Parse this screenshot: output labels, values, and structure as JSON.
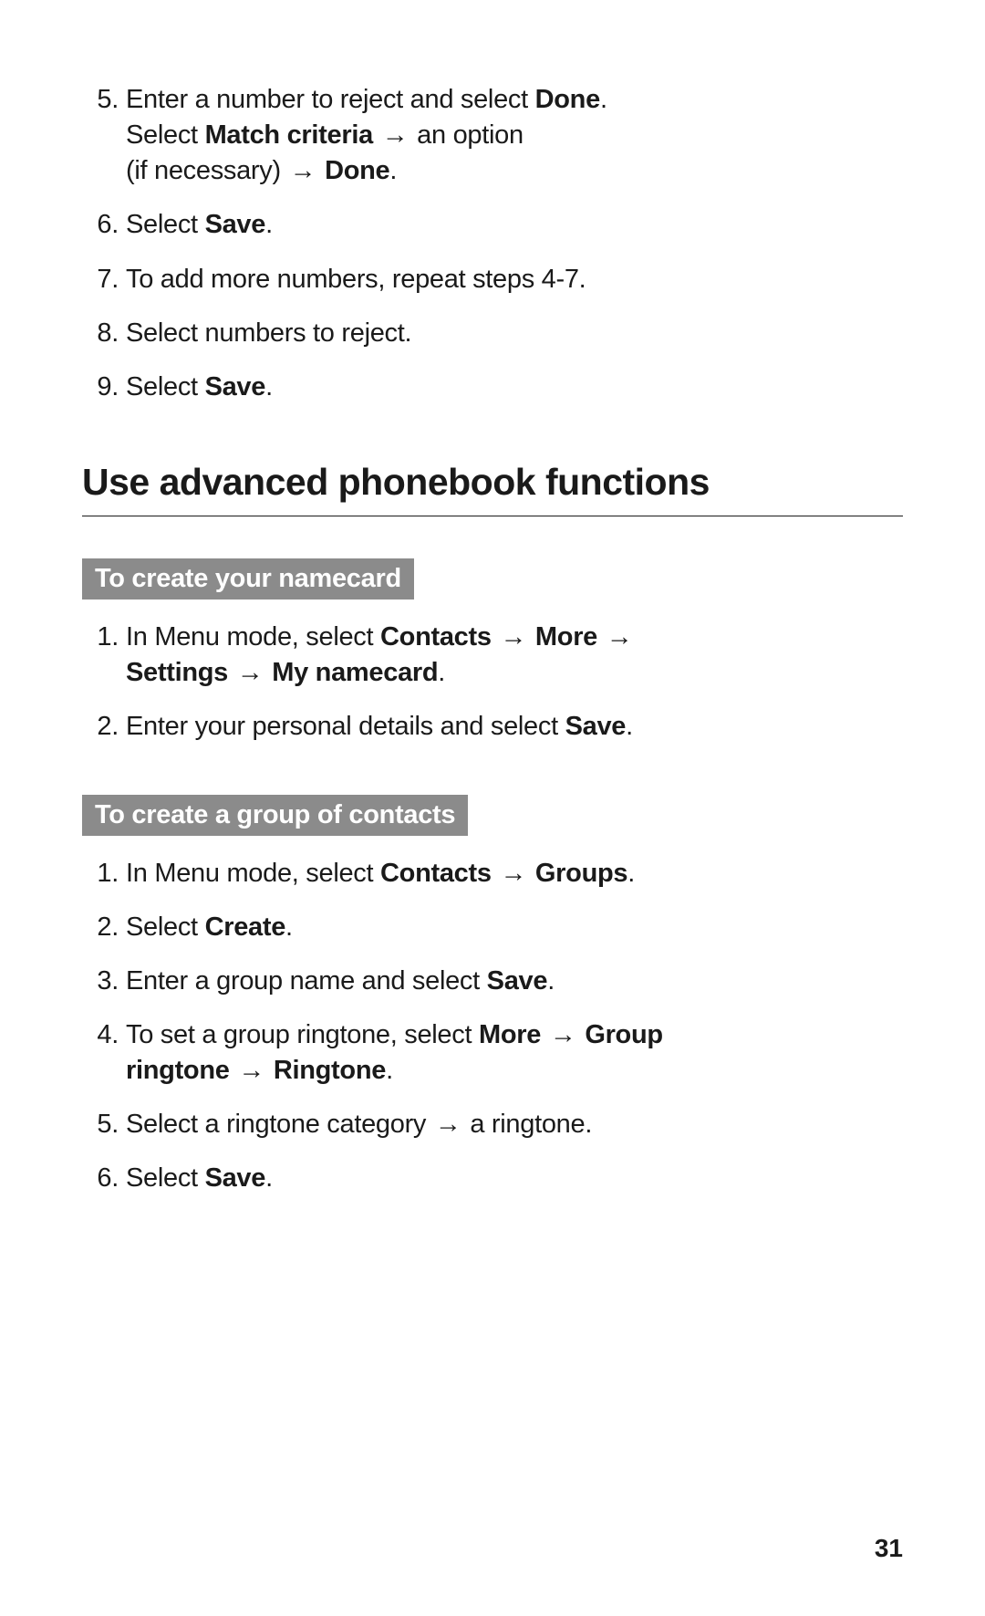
{
  "arrow": "→",
  "topList": [
    {
      "num": "5.",
      "segments": [
        {
          "t": "Enter a number to reject and select "
        },
        {
          "t": "Done",
          "b": true
        },
        {
          "t": "."
        },
        {
          "br": true
        },
        {
          "t": "Select "
        },
        {
          "t": "Match criteria",
          "b": true
        },
        {
          "t": " "
        },
        {
          "arrow": true
        },
        {
          "t": " an option"
        },
        {
          "br": true
        },
        {
          "t": "(if necessary) "
        },
        {
          "arrow": true
        },
        {
          "t": " "
        },
        {
          "t": "Done",
          "b": true
        },
        {
          "t": "."
        }
      ]
    },
    {
      "num": "6.",
      "segments": [
        {
          "t": "Select "
        },
        {
          "t": "Save",
          "b": true
        },
        {
          "t": "."
        }
      ]
    },
    {
      "num": "7.",
      "segments": [
        {
          "t": "To add more numbers, repeat steps 4-7."
        }
      ]
    },
    {
      "num": "8.",
      "segments": [
        {
          "t": "Select numbers to reject."
        }
      ]
    },
    {
      "num": "9.",
      "segments": [
        {
          "t": "Select "
        },
        {
          "t": "Save",
          "b": true
        },
        {
          "t": "."
        }
      ]
    }
  ],
  "sectionTitle": "Use advanced phonebook functions",
  "sub1": {
    "header": "To create your namecard",
    "items": [
      {
        "num": "1.",
        "segments": [
          {
            "t": "In Menu mode, select "
          },
          {
            "t": "Contacts",
            "b": true
          },
          {
            "t": " "
          },
          {
            "arrow": true
          },
          {
            "t": " "
          },
          {
            "t": "More",
            "b": true
          },
          {
            "t": " "
          },
          {
            "arrow": true
          },
          {
            "br": true
          },
          {
            "t": "Settings",
            "b": true
          },
          {
            "t": " "
          },
          {
            "arrow": true
          },
          {
            "t": " "
          },
          {
            "t": "My namecard",
            "b": true
          },
          {
            "t": "."
          }
        ]
      },
      {
        "num": "2.",
        "segments": [
          {
            "t": "Enter your personal details and select "
          },
          {
            "t": "Save",
            "b": true
          },
          {
            "t": "."
          }
        ]
      }
    ]
  },
  "sub2": {
    "header": "To create a group of contacts",
    "items": [
      {
        "num": "1.",
        "segments": [
          {
            "t": "In Menu mode, select "
          },
          {
            "t": "Contacts",
            "b": true
          },
          {
            "t": " "
          },
          {
            "arrow": true
          },
          {
            "t": " "
          },
          {
            "t": "Groups",
            "b": true
          },
          {
            "t": "."
          }
        ]
      },
      {
        "num": "2.",
        "segments": [
          {
            "t": "Select "
          },
          {
            "t": "Create",
            "b": true
          },
          {
            "t": "."
          }
        ]
      },
      {
        "num": "3.",
        "segments": [
          {
            "t": "Enter a group name and select "
          },
          {
            "t": "Save",
            "b": true
          },
          {
            "t": "."
          }
        ]
      },
      {
        "num": "4.",
        "segments": [
          {
            "t": "To set a group ringtone, select "
          },
          {
            "t": "More",
            "b": true
          },
          {
            "t": " "
          },
          {
            "arrow": true
          },
          {
            "t": " "
          },
          {
            "t": "Group",
            "b": true
          },
          {
            "br": true
          },
          {
            "t": "ringtone",
            "b": true
          },
          {
            "t": " "
          },
          {
            "arrow": true
          },
          {
            "t": " "
          },
          {
            "t": "Ringtone",
            "b": true
          },
          {
            "t": "."
          }
        ]
      },
      {
        "num": "5.",
        "segments": [
          {
            "t": "Select a ringtone category "
          },
          {
            "arrow": true
          },
          {
            "t": " a ringtone."
          }
        ]
      },
      {
        "num": "6.",
        "segments": [
          {
            "t": "Select "
          },
          {
            "t": "Save",
            "b": true
          },
          {
            "t": "."
          }
        ]
      }
    ]
  },
  "pageNumber": "31"
}
